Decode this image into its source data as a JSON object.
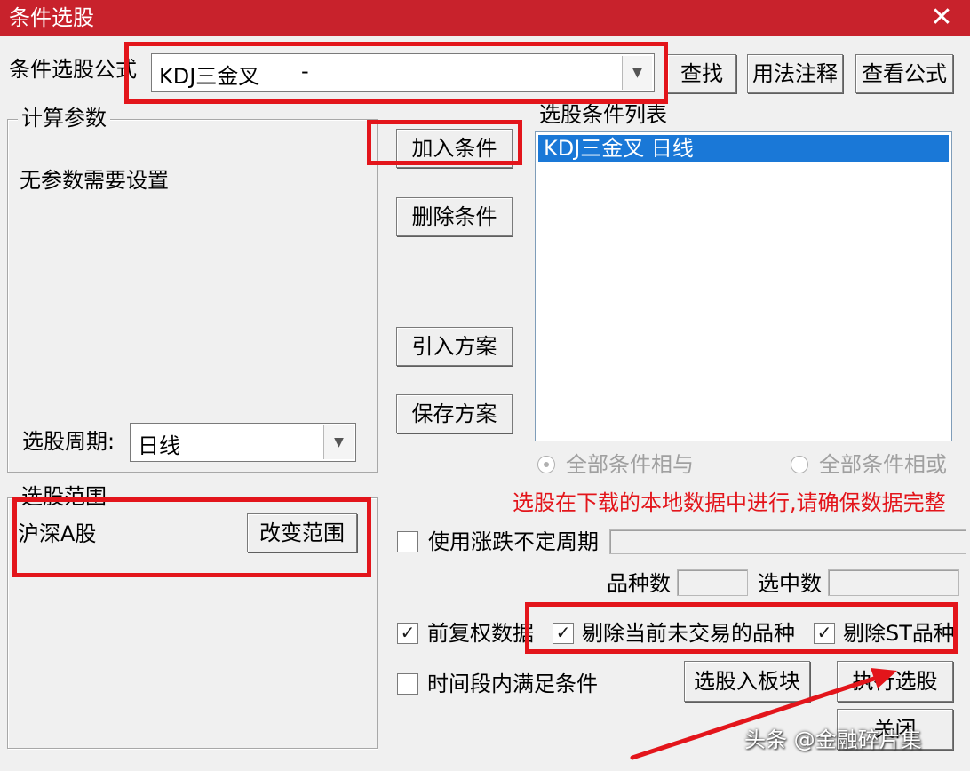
{
  "window": {
    "title": "条件选股",
    "close_glyph": "✕"
  },
  "formula": {
    "label": "条件选股公式",
    "value": "KDJ三金叉",
    "value_suffix": "-"
  },
  "buttons": {
    "find": "查找",
    "usage_notes": "用法注释",
    "view_formula": "查看公式",
    "add_condition": "加入条件",
    "delete_condition": "删除条件",
    "import_plan": "引入方案",
    "save_plan": "保存方案",
    "change_range": "改变范围",
    "to_block": "选股入板块",
    "execute": "执行选股",
    "close": "关闭"
  },
  "params": {
    "group_title": "计算参数",
    "message": "无参数需要设置",
    "period_label": "选股周期:",
    "period_value": "日线"
  },
  "condition_list": {
    "title": "选股条件列表",
    "items": [
      "KDJ三金叉   日线"
    ]
  },
  "logic": {
    "and_label": "全部条件相与",
    "or_label": "全部条件相或"
  },
  "warning": "选股在下载的本地数据中进行,请确保数据完整",
  "range": {
    "group_title": "选股范围",
    "value": "沪深A股"
  },
  "options": {
    "variable_period": {
      "label": "使用涨跌不定周期",
      "checked": false
    },
    "prev_restored": {
      "label": "前复权数据",
      "checked": true
    },
    "exclude_untraded": {
      "label": "剔除当前未交易的品种",
      "checked": true
    },
    "exclude_st": {
      "label": "剔除ST品种",
      "checked": true
    },
    "time_range": {
      "label": "时间段内满足条件",
      "checked": false
    }
  },
  "counts": {
    "total_label": "品种数",
    "selected_label": "选中数"
  },
  "watermark": "头条 @金融碎片集",
  "colors": {
    "titlebar": "#c8222c",
    "highlight": "#e3151b",
    "selection": "#1a78d7"
  }
}
